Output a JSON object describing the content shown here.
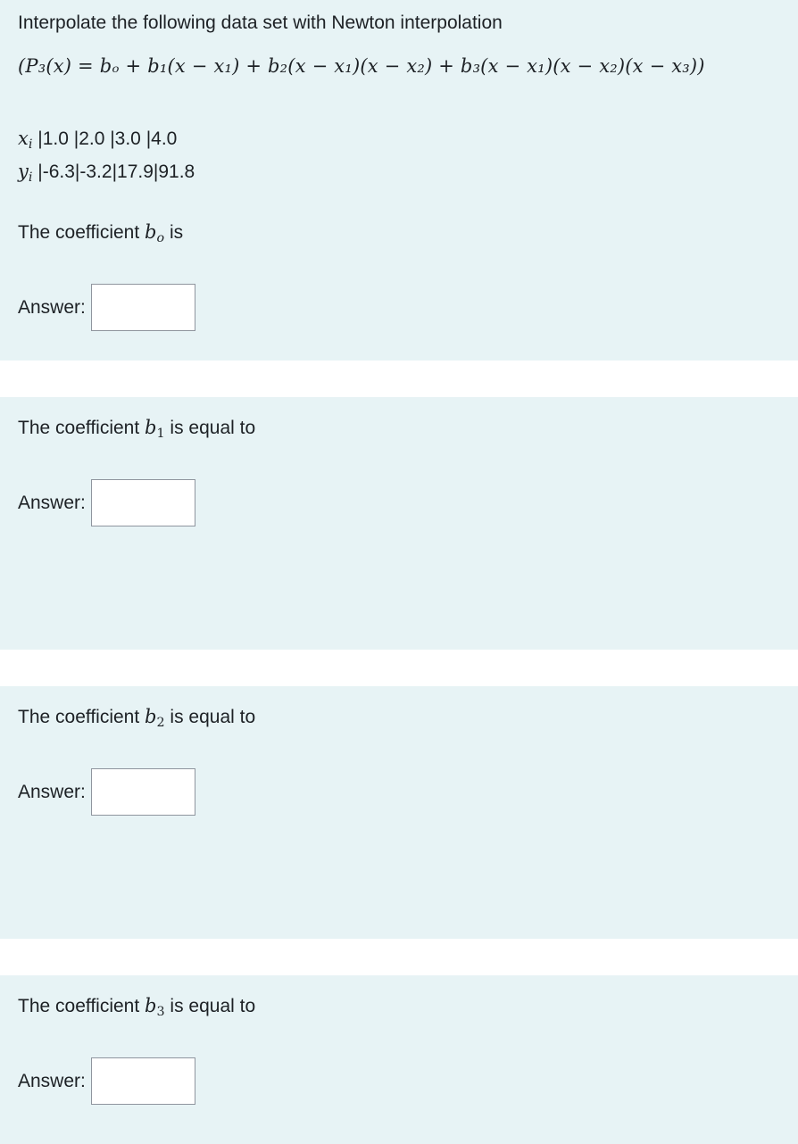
{
  "q1": {
    "intro": "Interpolate the following data set with Newton interpolation",
    "formula": "(P₃(x) = bₒ + b₁(x − x₁) + b₂(x − x₁)(x − x₂) + b₃(x − x₁)(x − x₂)(x − x₃))",
    "x_label": "x",
    "x_sub": "i",
    "x_values": "|1.0  |2.0  |3.0  |4.0",
    "y_label": "y",
    "y_sub": "i",
    "y_values": "|-6.3|-3.2|17.9|91.8",
    "prompt_pre": "The coefficient",
    "coef": "b",
    "coef_sub": "o",
    "prompt_post": "is",
    "answer_label": "Answer:",
    "answer_value": ""
  },
  "q2": {
    "prompt_pre": "The coefficient",
    "coef": "b",
    "coef_sub": "1",
    "prompt_post": "is equal to",
    "answer_label": "Answer:",
    "answer_value": ""
  },
  "q3": {
    "prompt_pre": "The coefficient",
    "coef": "b",
    "coef_sub": "2",
    "prompt_post": "is equal to",
    "answer_label": "Answer:",
    "answer_value": ""
  },
  "q4": {
    "prompt_pre": "The coefficient",
    "coef": "b",
    "coef_sub": "3",
    "prompt_post": "is equal to",
    "answer_label": "Answer:",
    "answer_value": ""
  }
}
